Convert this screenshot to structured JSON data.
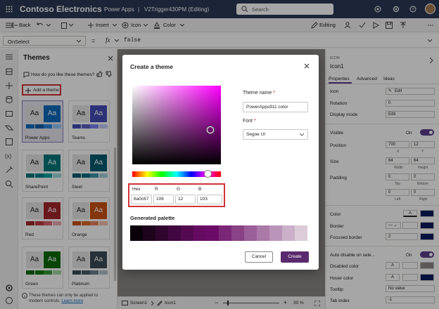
{
  "topbar": {
    "brand": "Contoso Electronics",
    "app": "Power Apps",
    "separator": "|",
    "document": "V2Trigger430PM (Editing)",
    "search_placeholder": "Search"
  },
  "command_bar": {
    "back": "Back",
    "insert": "Insert",
    "icon": "Icon",
    "color": "Color",
    "editing": "Editing"
  },
  "formula_bar": {
    "property": "OnSelect",
    "equals": "=",
    "fx": "fx",
    "formula": "false"
  },
  "themes_pane": {
    "title": "Themes",
    "feedback": "How do you like these themes?",
    "add_theme": "Add a theme",
    "themes": [
      {
        "name": "Power Apps",
        "sample": "Aa",
        "colors": [
          "#0f6cbd",
          "#115ea3",
          "#2886de",
          "#96c6fa"
        ]
      },
      {
        "name": "Teams",
        "sample": "Aa",
        "colors": [
          "#464eb8",
          "#5b5fc7",
          "#7f85f5",
          "#c5cbfa"
        ]
      },
      {
        "name": "SharePoint",
        "sample": "Aa",
        "colors": [
          "#03787c",
          "#038387",
          "#00a0a3",
          "#9bd9db"
        ]
      },
      {
        "name": "Steel",
        "sample": "Aa",
        "colors": [
          "#005b70",
          "#006e82",
          "#3a96a8",
          "#9fd0dc"
        ]
      },
      {
        "name": "Red",
        "sample": "Aa",
        "colors": [
          "#a4262c",
          "#c03b41",
          "#dc626d",
          "#eeacb2"
        ]
      },
      {
        "name": "Orange",
        "sample": "Aa",
        "colors": [
          "#ca5010",
          "#da6a25",
          "#e9835e",
          "#f4bfab"
        ]
      },
      {
        "name": "Green",
        "sample": "Aa",
        "colors": [
          "#0b6a0b",
          "#107c10",
          "#359b35",
          "#9fd89f"
        ]
      },
      {
        "name": "Platinum",
        "sample": "Aa",
        "colors": [
          "#3b4a54",
          "#4b5b66",
          "#6e7f8a",
          "#b3c1ca"
        ]
      }
    ],
    "footer_text": "These themes can only be applied to modern controls.",
    "footer_link": "Learn more"
  },
  "dialog": {
    "title": "Create a theme",
    "theme_name_label": "Theme name",
    "theme_name_value": "PowerApps911 color",
    "font_label": "Font",
    "font_value": "Segoe UI",
    "required_mark": "*",
    "hex_label": "Hex",
    "hex_value": "6a0c67",
    "r_label": "R",
    "r_value": "106",
    "g_label": "G",
    "g_value": "12",
    "b_label": "B",
    "b_value": "103",
    "palette_label": "Generated palette",
    "palette": [
      "#0a010a",
      "#1d031c",
      "#2f052d",
      "#410740",
      "#530a51",
      "#650c62",
      "#6a0c67",
      "#7a2777",
      "#8a4287",
      "#9a5e98",
      "#ab79a8",
      "#bb95b9",
      "#cbb0c9",
      "#dccbd9"
    ],
    "hue_base": "#ff00ff",
    "cancel": "Cancel",
    "create": "Create"
  },
  "canvas_status": {
    "screen": "Screen1",
    "control": "Icon1",
    "zoom": "30",
    "zoom_unit": "%"
  },
  "props": {
    "type": "ICON",
    "name": "Icon1",
    "tabs": [
      "Properties",
      "Advanced",
      "Ideas"
    ],
    "icon_label": "Icon",
    "icon_value": "Edit",
    "rotation_label": "Rotation",
    "rotation_value": "0",
    "display_mode_label": "Display mode",
    "display_mode_value": "Edit",
    "visible_label": "Visible",
    "visible_state": "On",
    "position_label": "Position",
    "pos_x": "700",
    "pos_y": "12",
    "x_label": "X",
    "y_label": "Y",
    "size_label": "Size",
    "width": "64",
    "height": "64",
    "width_label": "Width",
    "height_label": "Height",
    "padding_label": "Padding",
    "pad_top": "0",
    "pad_bottom": "0",
    "pad_left": "0",
    "pad_right": "0",
    "top_label": "Top",
    "bottom_label": "Bottom",
    "left_label": "Left",
    "right_label": "Right",
    "color_label": "Color",
    "border_label": "Border",
    "focused_border_label": "Focused border",
    "focused_border_value": "2",
    "auto_disable_label": "Auto disable on sele...",
    "auto_disable_state": "On",
    "disabled_color_label": "Disabled color",
    "hover_color_label": "Hover color",
    "tooltip_label": "Tooltip",
    "tooltip_value": "No value",
    "tab_index_label": "Tab index",
    "tab_index_value": "-1",
    "sample_glyph": "A"
  }
}
